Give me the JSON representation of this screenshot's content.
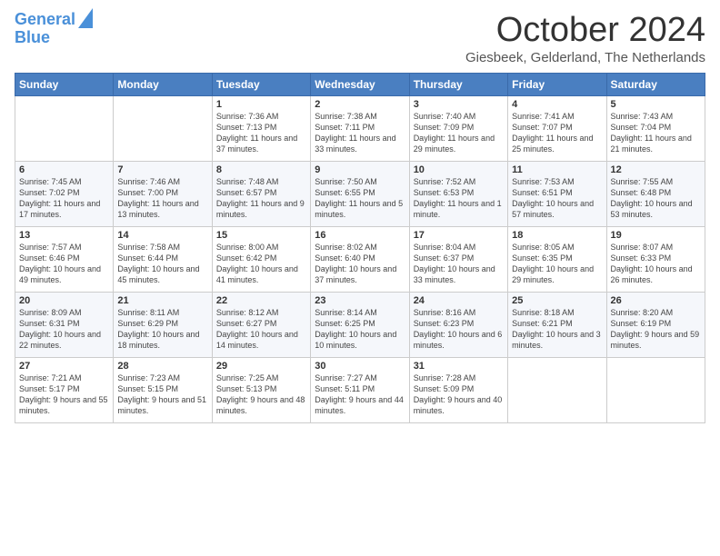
{
  "header": {
    "logo_line1": "General",
    "logo_line2": "Blue",
    "month": "October 2024",
    "location": "Giesbeek, Gelderland, The Netherlands"
  },
  "days_of_week": [
    "Sunday",
    "Monday",
    "Tuesday",
    "Wednesday",
    "Thursday",
    "Friday",
    "Saturday"
  ],
  "weeks": [
    [
      {
        "day": "",
        "info": ""
      },
      {
        "day": "",
        "info": ""
      },
      {
        "day": "1",
        "info": "Sunrise: 7:36 AM\nSunset: 7:13 PM\nDaylight: 11 hours and 37 minutes."
      },
      {
        "day": "2",
        "info": "Sunrise: 7:38 AM\nSunset: 7:11 PM\nDaylight: 11 hours and 33 minutes."
      },
      {
        "day": "3",
        "info": "Sunrise: 7:40 AM\nSunset: 7:09 PM\nDaylight: 11 hours and 29 minutes."
      },
      {
        "day": "4",
        "info": "Sunrise: 7:41 AM\nSunset: 7:07 PM\nDaylight: 11 hours and 25 minutes."
      },
      {
        "day": "5",
        "info": "Sunrise: 7:43 AM\nSunset: 7:04 PM\nDaylight: 11 hours and 21 minutes."
      }
    ],
    [
      {
        "day": "6",
        "info": "Sunrise: 7:45 AM\nSunset: 7:02 PM\nDaylight: 11 hours and 17 minutes."
      },
      {
        "day": "7",
        "info": "Sunrise: 7:46 AM\nSunset: 7:00 PM\nDaylight: 11 hours and 13 minutes."
      },
      {
        "day": "8",
        "info": "Sunrise: 7:48 AM\nSunset: 6:57 PM\nDaylight: 11 hours and 9 minutes."
      },
      {
        "day": "9",
        "info": "Sunrise: 7:50 AM\nSunset: 6:55 PM\nDaylight: 11 hours and 5 minutes."
      },
      {
        "day": "10",
        "info": "Sunrise: 7:52 AM\nSunset: 6:53 PM\nDaylight: 11 hours and 1 minute."
      },
      {
        "day": "11",
        "info": "Sunrise: 7:53 AM\nSunset: 6:51 PM\nDaylight: 10 hours and 57 minutes."
      },
      {
        "day": "12",
        "info": "Sunrise: 7:55 AM\nSunset: 6:48 PM\nDaylight: 10 hours and 53 minutes."
      }
    ],
    [
      {
        "day": "13",
        "info": "Sunrise: 7:57 AM\nSunset: 6:46 PM\nDaylight: 10 hours and 49 minutes."
      },
      {
        "day": "14",
        "info": "Sunrise: 7:58 AM\nSunset: 6:44 PM\nDaylight: 10 hours and 45 minutes."
      },
      {
        "day": "15",
        "info": "Sunrise: 8:00 AM\nSunset: 6:42 PM\nDaylight: 10 hours and 41 minutes."
      },
      {
        "day": "16",
        "info": "Sunrise: 8:02 AM\nSunset: 6:40 PM\nDaylight: 10 hours and 37 minutes."
      },
      {
        "day": "17",
        "info": "Sunrise: 8:04 AM\nSunset: 6:37 PM\nDaylight: 10 hours and 33 minutes."
      },
      {
        "day": "18",
        "info": "Sunrise: 8:05 AM\nSunset: 6:35 PM\nDaylight: 10 hours and 29 minutes."
      },
      {
        "day": "19",
        "info": "Sunrise: 8:07 AM\nSunset: 6:33 PM\nDaylight: 10 hours and 26 minutes."
      }
    ],
    [
      {
        "day": "20",
        "info": "Sunrise: 8:09 AM\nSunset: 6:31 PM\nDaylight: 10 hours and 22 minutes."
      },
      {
        "day": "21",
        "info": "Sunrise: 8:11 AM\nSunset: 6:29 PM\nDaylight: 10 hours and 18 minutes."
      },
      {
        "day": "22",
        "info": "Sunrise: 8:12 AM\nSunset: 6:27 PM\nDaylight: 10 hours and 14 minutes."
      },
      {
        "day": "23",
        "info": "Sunrise: 8:14 AM\nSunset: 6:25 PM\nDaylight: 10 hours and 10 minutes."
      },
      {
        "day": "24",
        "info": "Sunrise: 8:16 AM\nSunset: 6:23 PM\nDaylight: 10 hours and 6 minutes."
      },
      {
        "day": "25",
        "info": "Sunrise: 8:18 AM\nSunset: 6:21 PM\nDaylight: 10 hours and 3 minutes."
      },
      {
        "day": "26",
        "info": "Sunrise: 8:20 AM\nSunset: 6:19 PM\nDaylight: 9 hours and 59 minutes."
      }
    ],
    [
      {
        "day": "27",
        "info": "Sunrise: 7:21 AM\nSunset: 5:17 PM\nDaylight: 9 hours and 55 minutes."
      },
      {
        "day": "28",
        "info": "Sunrise: 7:23 AM\nSunset: 5:15 PM\nDaylight: 9 hours and 51 minutes."
      },
      {
        "day": "29",
        "info": "Sunrise: 7:25 AM\nSunset: 5:13 PM\nDaylight: 9 hours and 48 minutes."
      },
      {
        "day": "30",
        "info": "Sunrise: 7:27 AM\nSunset: 5:11 PM\nDaylight: 9 hours and 44 minutes."
      },
      {
        "day": "31",
        "info": "Sunrise: 7:28 AM\nSunset: 5:09 PM\nDaylight: 9 hours and 40 minutes."
      },
      {
        "day": "",
        "info": ""
      },
      {
        "day": "",
        "info": ""
      }
    ]
  ]
}
